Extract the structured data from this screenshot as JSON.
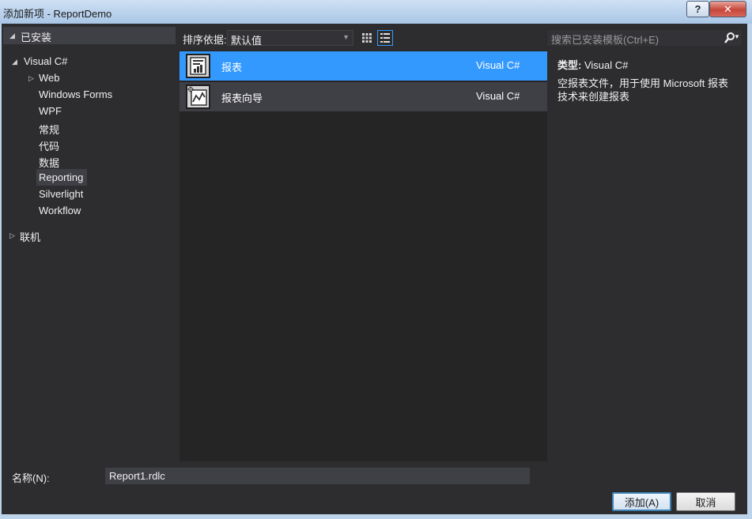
{
  "window": {
    "title": "添加新项 - ReportDemo",
    "help_label": "?",
    "close_label": "✕"
  },
  "tree": {
    "installed_label": "已安装",
    "root_label": "Visual C#",
    "items": [
      {
        "label": "Web",
        "expandable": true
      },
      {
        "label": "Windows Forms"
      },
      {
        "label": "WPF"
      },
      {
        "label": "常规"
      },
      {
        "label": "代码"
      },
      {
        "label": "数据"
      },
      {
        "label": "Reporting",
        "selected": true
      },
      {
        "label": "Silverlight"
      },
      {
        "label": "Workflow"
      }
    ],
    "online_label": "联机"
  },
  "toolbar": {
    "sort_label": "排序依据:",
    "sort_value": "默认值",
    "search_placeholder": "搜索已安装模板(Ctrl+E)"
  },
  "templates": [
    {
      "name": "报表",
      "language": "Visual C#",
      "selected": true,
      "icon": "report-icon"
    },
    {
      "name": "报表向导",
      "language": "Visual C#",
      "selected": false,
      "icon": "report-wizard-icon"
    }
  ],
  "details": {
    "type_label": "类型:",
    "type_value": "Visual C#",
    "description": "空报表文件，用于使用 Microsoft 报表技术来创建报表"
  },
  "footer": {
    "name_label": "名称(N):",
    "name_value": "Report1.rdlc",
    "add_label": "添加(A)",
    "cancel_label": "取消"
  },
  "colors": {
    "selection": "#3399ff",
    "background": "#2d2d30",
    "list_background": "#252526"
  }
}
